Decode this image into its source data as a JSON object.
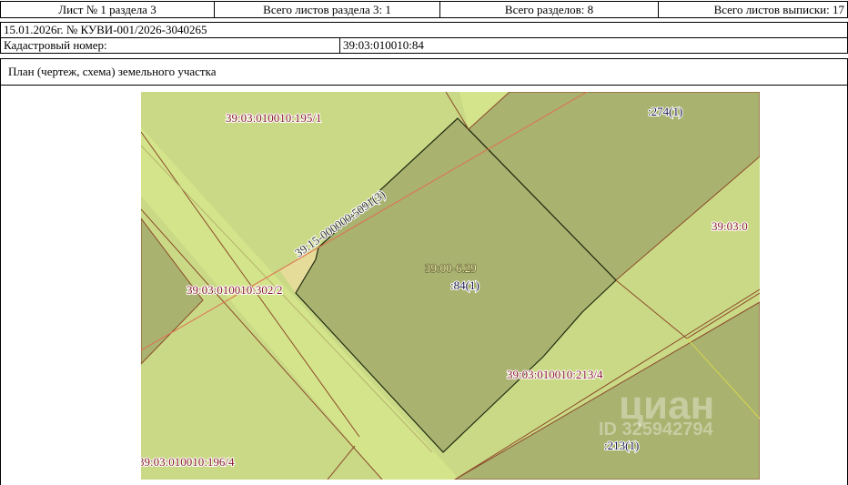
{
  "header": {
    "sheet": "Лист № 1 раздела 3",
    "sheets_in_section": "Всего листов раздела 3: 1",
    "sections_total": "Всего разделов: 8",
    "sheets_total": "Всего листов выписки: 17"
  },
  "document_line": "15.01.2026г. № КУВИ-001/2026-3040265",
  "cadastral": {
    "label": "Кадастровый номер:",
    "value": "39:03:010010:84"
  },
  "plan_title": "План (чертеж, схема) земельного участка",
  "map": {
    "colors": {
      "light": "#cad985",
      "strip": "#d4e48b",
      "dark": "#a9b26f",
      "boundary": "#8b4a2b",
      "red_line": "#e0704f"
    },
    "labels": {
      "p195": "39:03:010010:195/1",
      "p274": ":274(1)",
      "p5091": "39:15-000000:5091(3)",
      "right": "39:03:0",
      "zone": "39:00-6.29",
      "p84": ":84(1)",
      "p302": "39:03:010010:302/2",
      "p213_4": "39:03:010010:213/4",
      "p213": ":213(1)",
      "p196": "39:03:010010:196/4"
    },
    "watermark": {
      "brand": "циан",
      "id": "ID 325942794"
    }
  }
}
